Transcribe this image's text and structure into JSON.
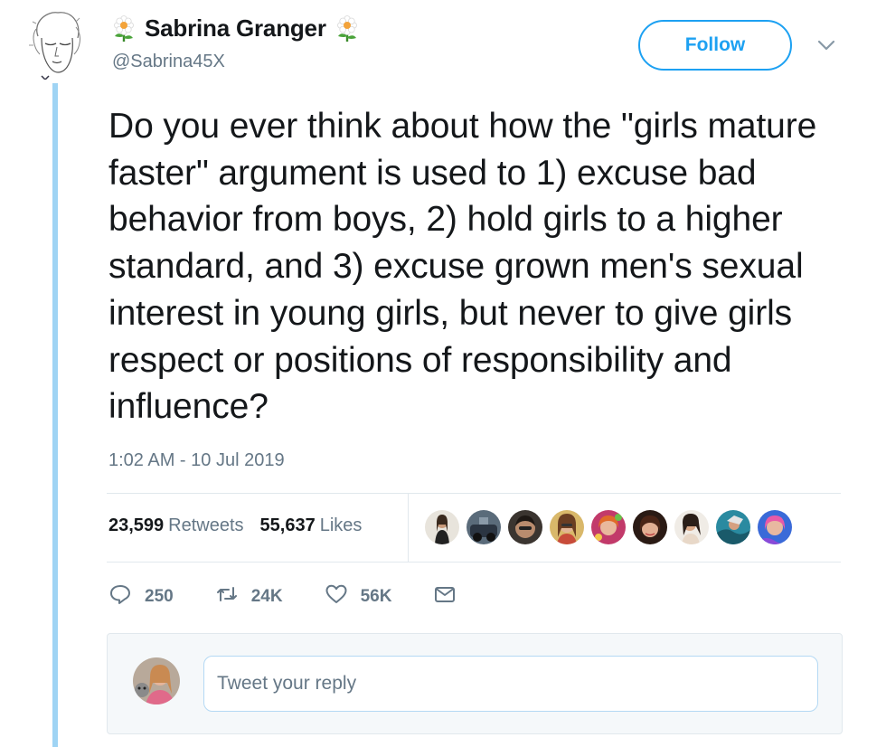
{
  "author": {
    "display_name": "Sabrina Granger",
    "handle": "@Sabrina45X",
    "name_emoji": "flower-icon"
  },
  "header": {
    "follow_label": "Follow",
    "menu_icon": "chevron-down-icon"
  },
  "tweet": {
    "text": "Do you ever think about how the \"girls mature faster\" argument is used to 1) excuse bad behavior from boys, 2) hold girls to a higher standard, and 3) excuse grown men's sexual interest in young girls, but never to give girls respect or positions of responsibility and influence?",
    "timestamp": "1:02 AM - 10 Jul 2019"
  },
  "stats": {
    "retweets_count": "23,599",
    "retweets_label": "Retweets",
    "likes_count": "55,637",
    "likes_label": "Likes",
    "liker_avatars": [
      "liker-avatar-1",
      "liker-avatar-2",
      "liker-avatar-3",
      "liker-avatar-4",
      "liker-avatar-5",
      "liker-avatar-6",
      "liker-avatar-7",
      "liker-avatar-8",
      "liker-avatar-9"
    ]
  },
  "actions": {
    "reply_count": "250",
    "retweet_count": "24K",
    "like_count": "56K"
  },
  "reply": {
    "placeholder": "Tweet your reply"
  },
  "colors": {
    "accent": "#1da1f2",
    "thread_line": "#9fd4f4",
    "muted_text": "#657786",
    "divider": "#e1e8ed"
  }
}
